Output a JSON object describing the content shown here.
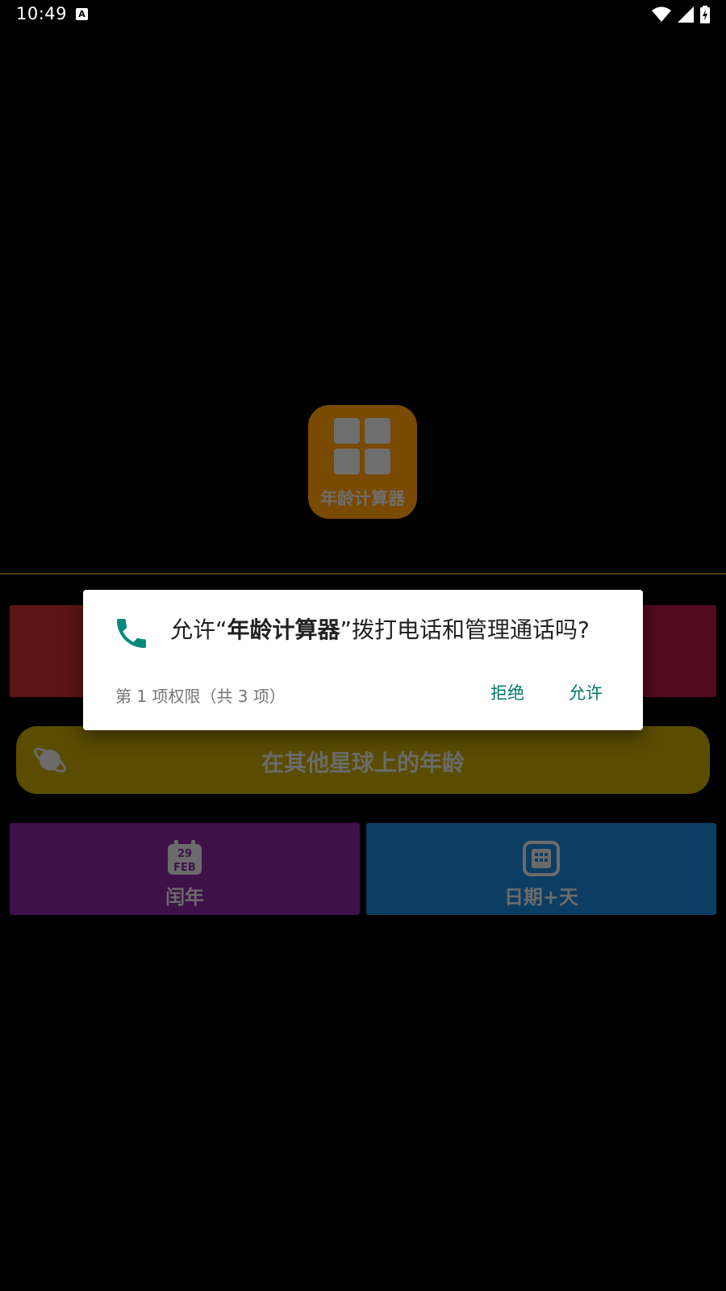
{
  "status_bar": {
    "time": "10:49",
    "notification_icon": "A",
    "icons": [
      "wifi-icon",
      "signal-icon",
      "battery-charging-icon"
    ]
  },
  "app": {
    "logo_text": "年龄计算器"
  },
  "tiles": {
    "planet_label": "在其他星球上的年龄",
    "leap_year_label": "闰年",
    "leap_year_icon_day": "29",
    "leap_year_icon_month": "FEB",
    "date_plus_days_label": "日期+天"
  },
  "dialog": {
    "message_prefix": "允许“",
    "app_name": "年龄计算器",
    "message_suffix": "”拨打电话和管理通话吗?",
    "counter": "第 1 项权限（共 3 项）",
    "deny_label": "拒绝",
    "allow_label": "允许"
  },
  "colors": {
    "accent": "#00796b",
    "logo_bg": "#7a4a02",
    "planet_bg": "#5a4c00",
    "leap_bg": "#3e1148",
    "date_bg": "#0c3d62"
  }
}
